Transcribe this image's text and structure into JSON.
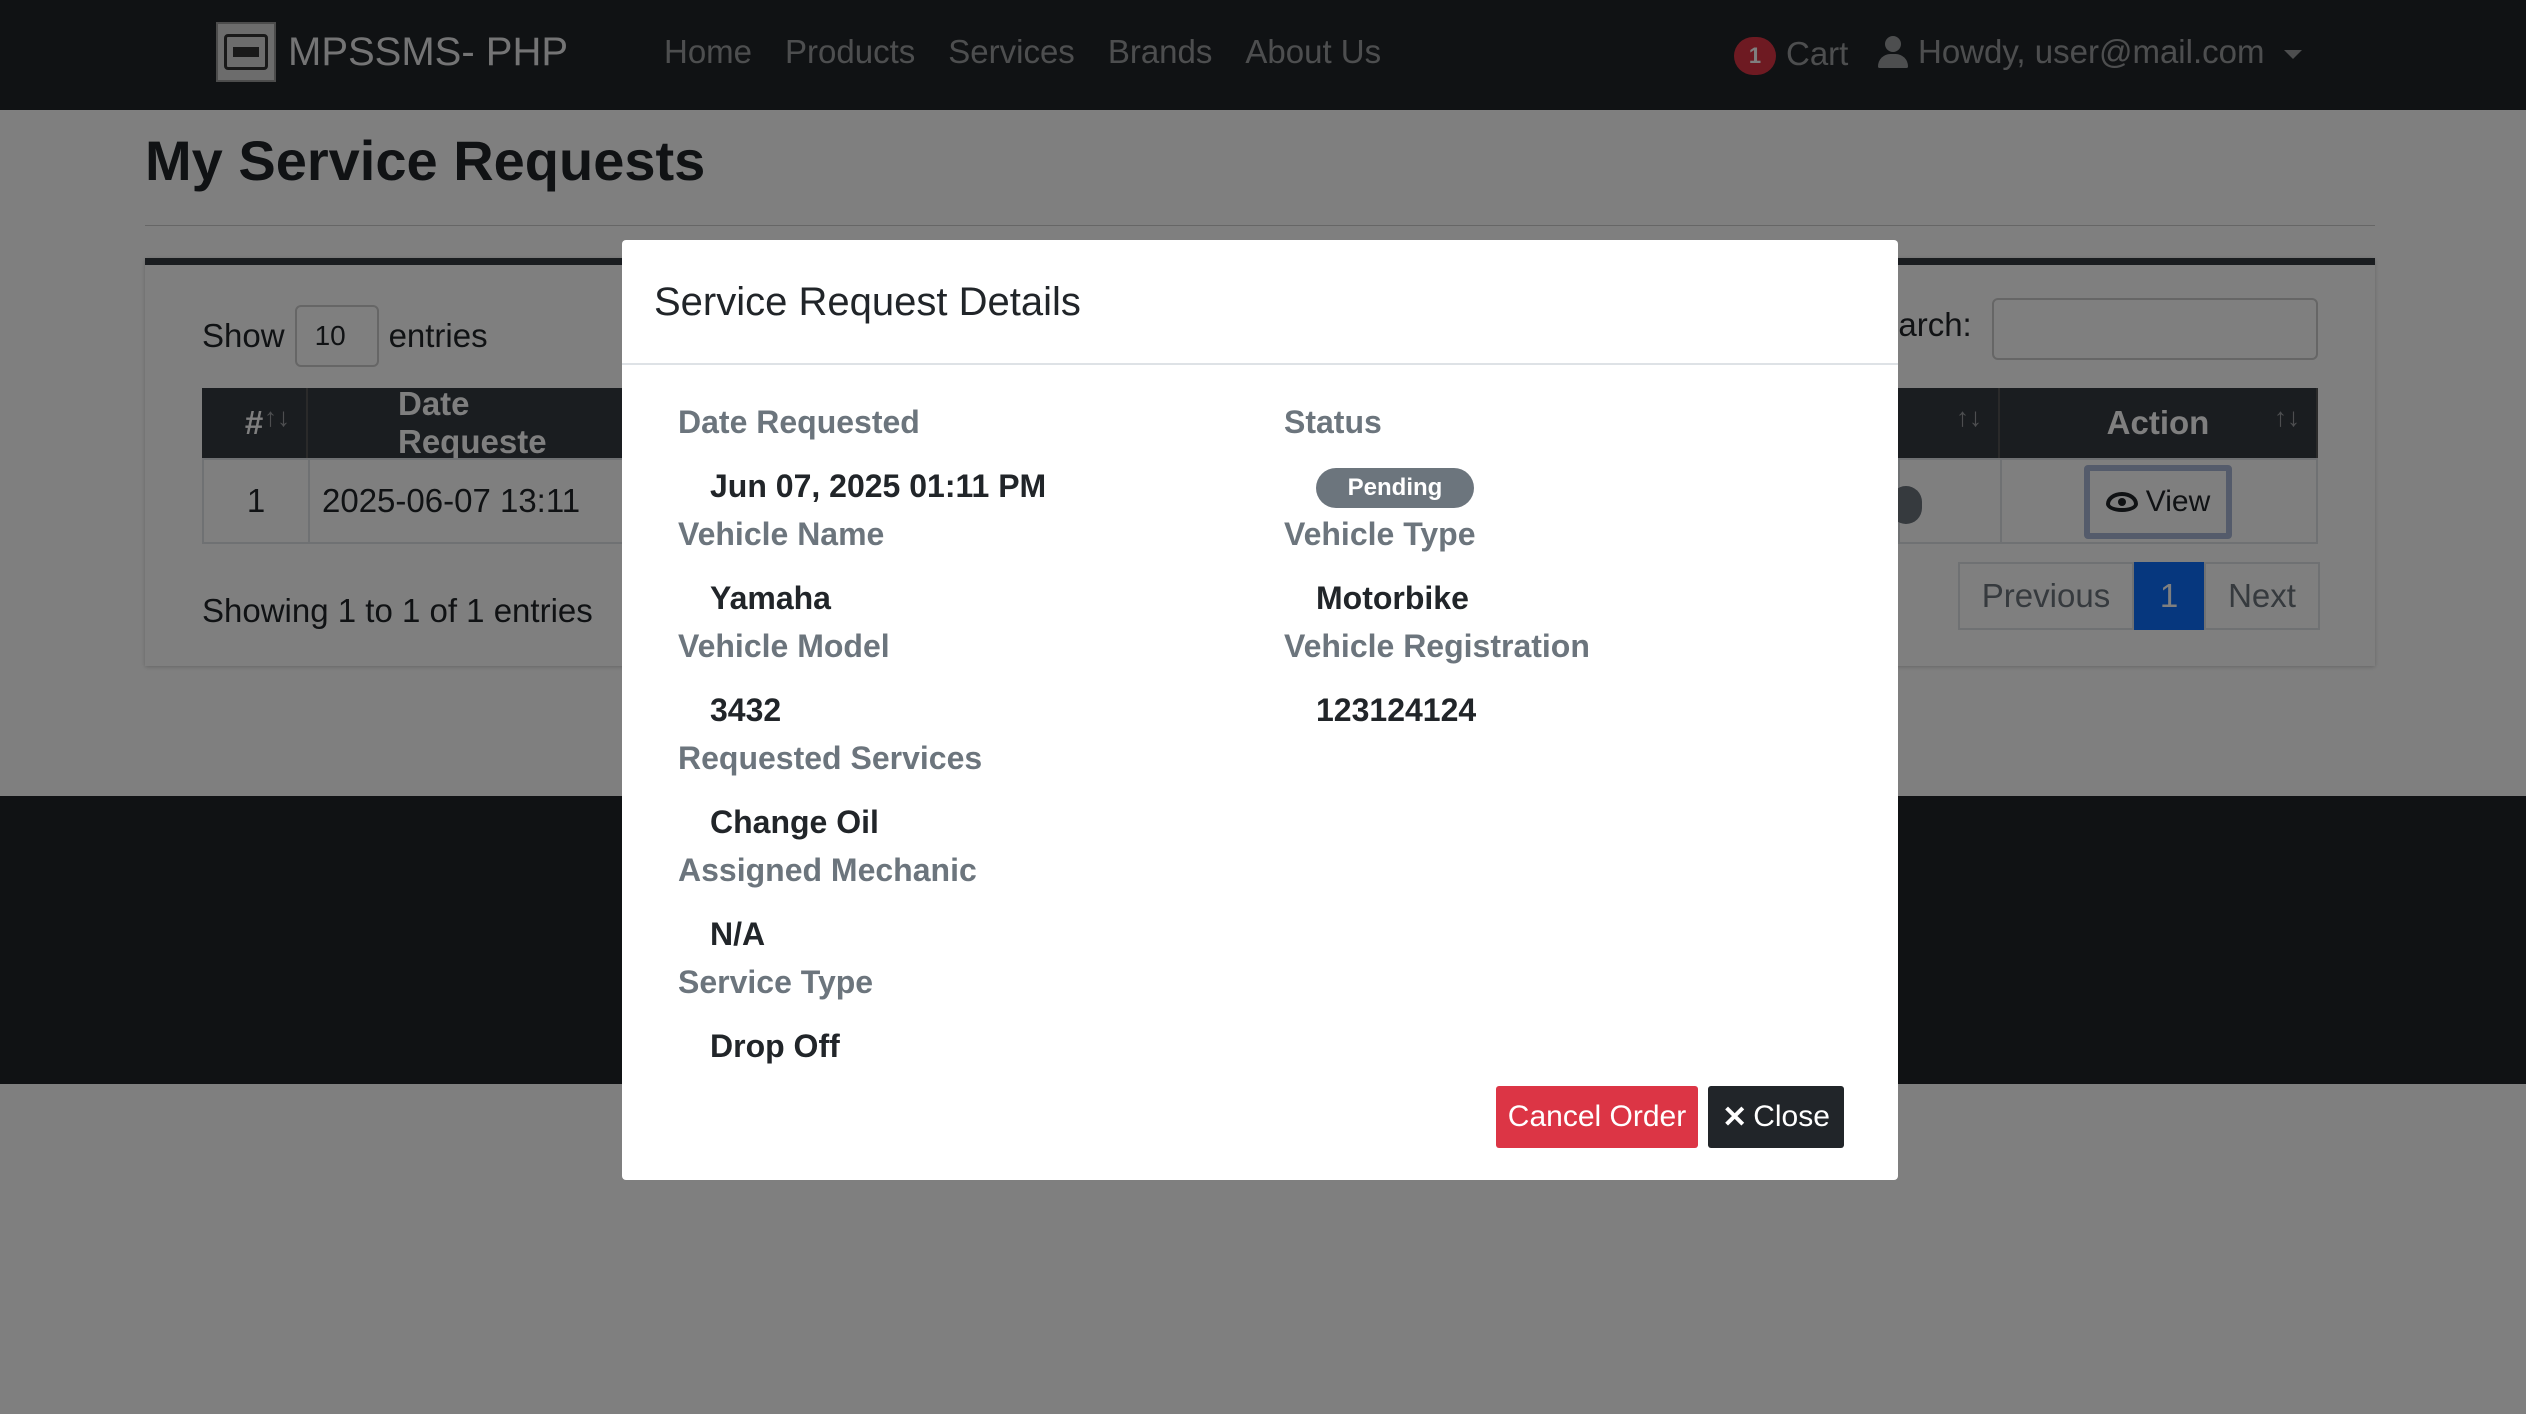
{
  "navbar": {
    "brand": "MPSSMS- PHP",
    "links": [
      "Home",
      "Products",
      "Services",
      "Brands",
      "About Us"
    ],
    "cart_count": "1",
    "cart_label": "Cart",
    "user_label": "Howdy, user@mail.com"
  },
  "page": {
    "title": "My Service Requests"
  },
  "table_controls": {
    "show": "Show",
    "length_value": "10",
    "entries": "entries",
    "search_label": "earch:"
  },
  "table": {
    "headers": [
      "#",
      "Date Requeste",
      "Action"
    ],
    "rows": [
      {
        "index": "1",
        "date": "2025-06-07 13:11",
        "action": "View"
      }
    ],
    "info": "Showing 1 to 1 of 1 entries",
    "pager": {
      "previous": "Previous",
      "current": "1",
      "next": "Next"
    }
  },
  "modal": {
    "title": "Service Request Details",
    "fields": {
      "date_requested": {
        "label": "Date Requested",
        "value": "Jun 07, 2025 01:11 PM"
      },
      "status": {
        "label": "Status",
        "value": "Pending"
      },
      "vehicle_name": {
        "label": "Vehicle Name",
        "value": "Yamaha"
      },
      "vehicle_type": {
        "label": "Vehicle Type",
        "value": "Motorbike"
      },
      "vehicle_model": {
        "label": "Vehicle Model",
        "value": "3432"
      },
      "vehicle_registration": {
        "label": "Vehicle Registration",
        "value": "123124124"
      },
      "requested_services": {
        "label": "Requested Services",
        "value": "Change Oil"
      },
      "assigned_mechanic": {
        "label": "Assigned Mechanic",
        "value": "N/A"
      },
      "service_type": {
        "label": "Service Type",
        "value": "Drop Off"
      }
    },
    "buttons": {
      "cancel": "Cancel Order",
      "close": "Close"
    }
  },
  "colors": {
    "navbar": "#212529",
    "danger": "#dc3545",
    "primary": "#0d6efd",
    "secondary": "#6c757d"
  }
}
